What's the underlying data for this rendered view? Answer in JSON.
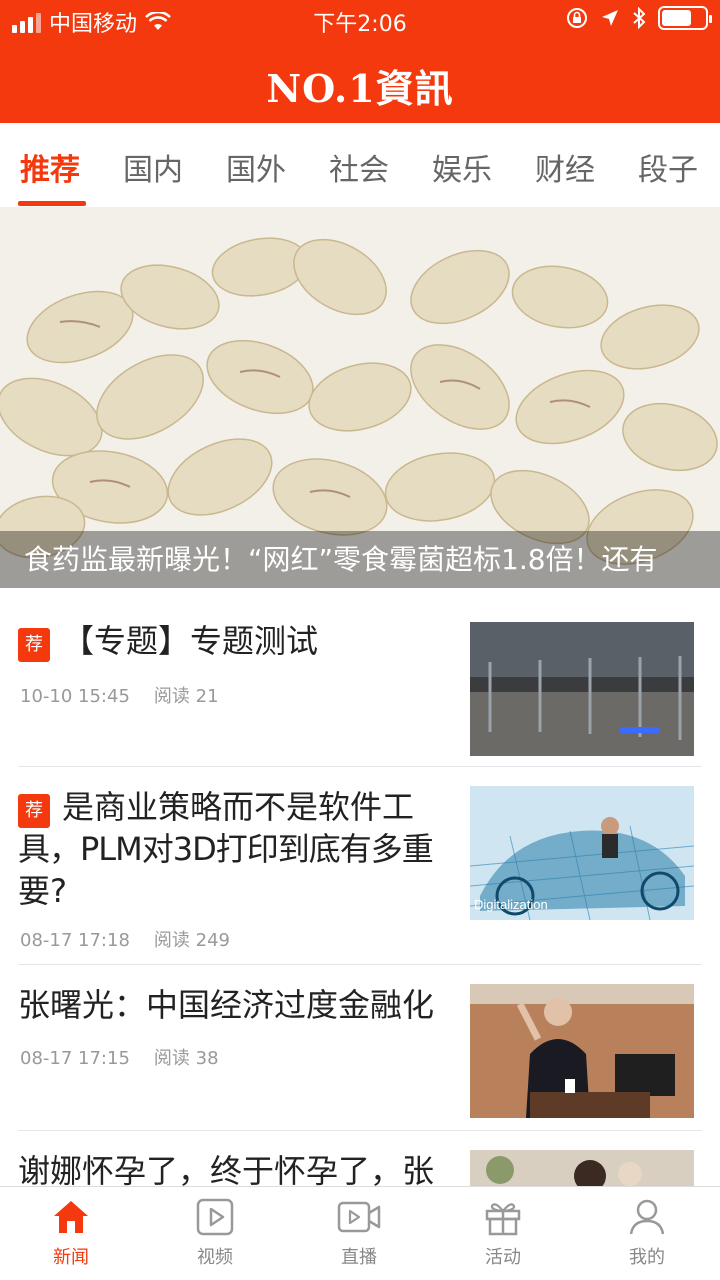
{
  "status_bar": {
    "carrier": "中国移动",
    "time": "下午2:06"
  },
  "app": {
    "title": "NO.1資訊"
  },
  "tabs": [
    {
      "label": "推荐",
      "active": true
    },
    {
      "label": "国内"
    },
    {
      "label": "国外"
    },
    {
      "label": "社会"
    },
    {
      "label": "娱乐"
    },
    {
      "label": "财经"
    },
    {
      "label": "段子"
    }
  ],
  "hero": {
    "caption": "食药监最新曝光！“网红”零食霉菌超标1.8倍！还有"
  },
  "articles": [
    {
      "badge": "荐",
      "title": "【专题】专题测试",
      "time": "10-10 15:45",
      "reads": "阅读 21"
    },
    {
      "badge": "荐",
      "title_line1": "是商业策略而不是软件工",
      "title_line2": "具，PLM对3D打印到底有多重",
      "title_line3": "要?",
      "time": "08-17 17:18",
      "reads": "阅读 249",
      "thumb_label": "Digitalization"
    },
    {
      "title": "张曙光：中国经济过度金融化",
      "time": "08-17 17:15",
      "reads": "阅读 38"
    },
    {
      "title": "谢娜怀孕了，终于怀孕了，张"
    }
  ],
  "tabbar": [
    {
      "label": "新闻",
      "icon": "home-icon",
      "active": true
    },
    {
      "label": "视频",
      "icon": "play-icon"
    },
    {
      "label": "直播",
      "icon": "live-video-icon"
    },
    {
      "label": "活动",
      "icon": "gift-icon"
    },
    {
      "label": "我的",
      "icon": "user-icon"
    }
  ],
  "colors": {
    "brand": "#f4390e",
    "text": "#222222",
    "muted": "#999999"
  }
}
